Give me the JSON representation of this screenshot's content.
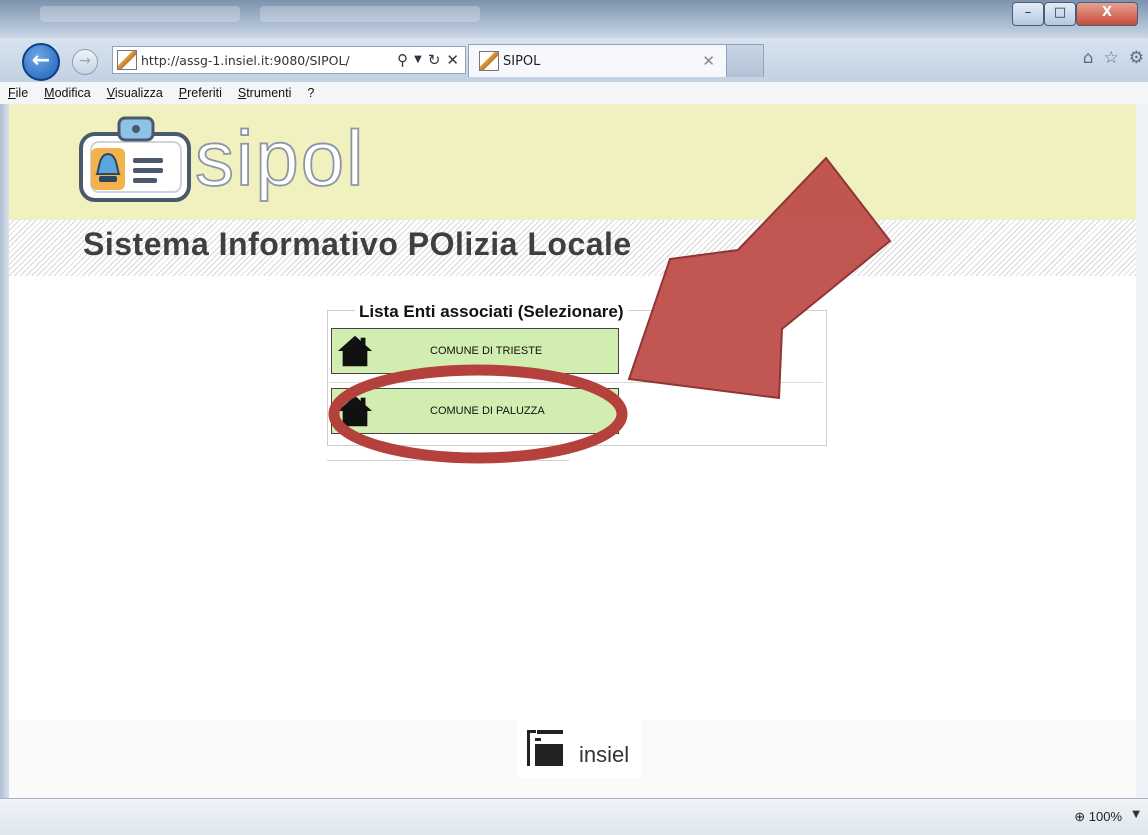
{
  "browser": {
    "url": "http://assg-1.insiel.it:9080/SIPOL/",
    "url_host_part": "assg-1.insiel.it",
    "tab_title": "SIPOL",
    "menu": [
      "File",
      "Modifica",
      "Visualizza",
      "Preferiti",
      "Strumenti",
      "?"
    ],
    "zoom": "100%"
  },
  "window_controls": {
    "minimize": "–",
    "maximize": "□",
    "close": "X"
  },
  "header": {
    "logo_text": "sipol",
    "subtitle": "Sistema Informativo POlizia Locale"
  },
  "panel": {
    "title": "Lista Enti associati (Selezionare)",
    "entries": [
      {
        "label": "COMUNE DI TRIESTE"
      },
      {
        "label": "COMUNE DI PALUZZA"
      }
    ]
  },
  "footer": {
    "brand": "insiel"
  },
  "annotation": {
    "arrow_color": "#c0504d",
    "ellipse_color": "#b5413d"
  }
}
